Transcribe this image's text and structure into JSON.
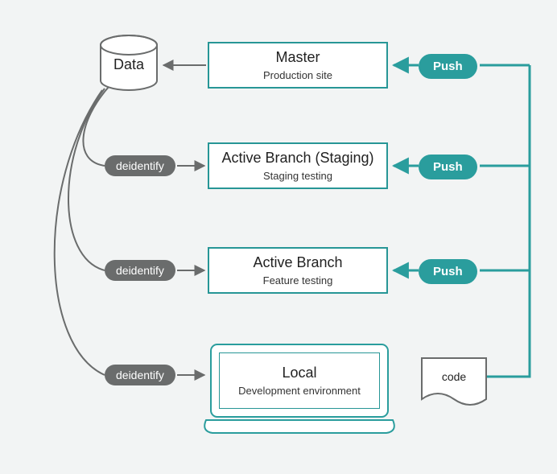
{
  "diagram": {
    "data_node": {
      "label": "Data"
    },
    "master": {
      "title": "Master",
      "subtitle": "Production site"
    },
    "staging": {
      "title": "Active Branch (Staging)",
      "subtitle": "Staging testing"
    },
    "feature": {
      "title": "Active Branch",
      "subtitle": "Feature testing"
    },
    "local": {
      "title": "Local",
      "subtitle": "Development environment"
    },
    "code_doc": {
      "label": "code"
    },
    "push_labels": {
      "master": "Push",
      "staging": "Push",
      "feature": "Push"
    },
    "deidentify_labels": {
      "staging": "deidentify",
      "feature": "deidentify",
      "local": "deidentify"
    }
  },
  "flow_edges": [
    {
      "from": "master",
      "to": "data",
      "label": null,
      "kind": "arrow"
    },
    {
      "from": "data",
      "to": "staging",
      "label": "deidentify",
      "kind": "curve"
    },
    {
      "from": "data",
      "to": "feature",
      "label": "deidentify",
      "kind": "curve"
    },
    {
      "from": "data",
      "to": "local",
      "label": "deidentify",
      "kind": "curve"
    },
    {
      "from": "code",
      "to": "master",
      "label": "Push",
      "kind": "bus"
    },
    {
      "from": "code",
      "to": "staging",
      "label": "Push",
      "kind": "bus"
    },
    {
      "from": "code",
      "to": "feature",
      "label": "Push",
      "kind": "bus"
    }
  ],
  "colors": {
    "teal": "#2a9d9d",
    "gray": "#6a6c6c",
    "bg": "#f2f4f4"
  }
}
